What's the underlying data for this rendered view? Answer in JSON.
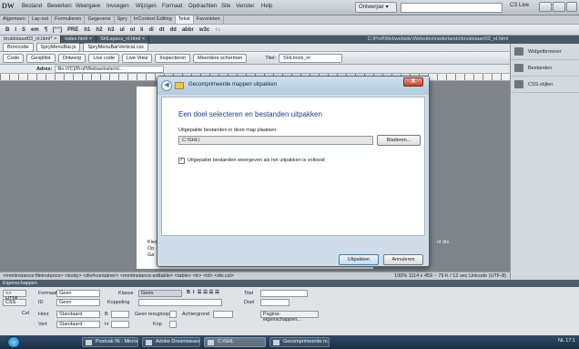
{
  "app": {
    "logo": "DW",
    "menu": [
      "Bestand",
      "Bewerken",
      "Weergave",
      "Invoegen",
      "Wijzigen",
      "Formaat",
      "Opdrachten",
      "Site",
      "Venster",
      "Help"
    ],
    "workspace": "Ontwerper ▾",
    "cslive": "CS Live"
  },
  "insert_tabs": [
    "Algemeen",
    "Lay-out",
    "Formulieren",
    "Gegevens",
    "Spry",
    "InContext Editing",
    "Tekst",
    "Favorieten"
  ],
  "format_bar": [
    "B",
    "I",
    "S",
    "em",
    "¶",
    "[“”]",
    "PRE",
    "h1",
    "h2",
    "h3",
    "ul",
    "ol",
    "li",
    "dl",
    "dt",
    "dd",
    "abbr",
    "w3c",
    "↑↓"
  ],
  "doc_tabs": [
    "bruidstaart03_nl.html* ×",
    "index.html ×",
    "SHLspecs_nl.html ×"
  ],
  "doc_path": "C:\\Prof\\Webwebsite\\Websites\\nederlands\\bruidstaart03_nl.html",
  "related_files": [
    "Broncode",
    "SpryMenuBar.js",
    "SpryMenuBarVertical.css"
  ],
  "doc_toolbar": {
    "buttons": [
      "Code",
      "Gesplitst",
      "Ontwerp",
      "Live code",
      "Live View",
      "Inspecteren",
      "Meerdere schermen"
    ],
    "title_label": "Titel:",
    "title_value": "SHLtools_nl"
  },
  "address": {
    "label": "Adres:",
    "value": "file:///C|/Prof/Webwebsite/nl..."
  },
  "status": {
    "left": "<mmtinstance:fileinstance> <body> <div#container> <mmtinstance:editable> <table> <tr> <td> <div.col>",
    "right": "100%  1114 x 459 ~ 79 K / 12 sec  Unicode (UTF-8)"
  },
  "right_panel": [
    "Widgetbrowser",
    "Bestanden",
    "CSS-stijlen"
  ],
  "background_text": {
    "left": [
      "Kiez",
      "Op",
      "Ga"
    ],
    "right": "nt die"
  },
  "properties": {
    "header": "Eigenschappen",
    "html_btn": "<> HTML",
    "css_btn": "CSS",
    "format_label": "Formaat",
    "format_value": "Geen",
    "class_label": "Klasse",
    "class_value": "Geen",
    "id_label": "ID",
    "id_value": "Geen",
    "link_label": "Koppeling",
    "title_label": "Titel",
    "target_label": "Doel",
    "cell_label": "Cel",
    "horz_label": "Horz",
    "horz_value": "Standaard",
    "vert_label": "Vert",
    "vert_value": "Standaard",
    "w_label": "B",
    "h_label": "H",
    "nowrap_label": "Geen terugloop",
    "header_label": "Kop",
    "bg_label": "Achtergrond",
    "page_props_btn": "Pagina-eigenschappen..."
  },
  "dialog": {
    "caption": "Gecomprimeerde mappen uitpakken",
    "close": "X",
    "heading": "Een doel selecteren en bestanden uitpakken",
    "path_label": "Uitgepakte bestanden in deze map plaatsen:",
    "path_value": "C:\\SHL\\",
    "browse": "Bladeren...",
    "checkbox_checked": true,
    "checkbox_label": "Uitgepakte bestanden weergeven als het uitpakken is voltooid",
    "extract": "Uitpakken",
    "cancel": "Annuleren"
  },
  "taskbar": {
    "tasks": [
      "Postvak IN - Micros...",
      "Adobe Dreamweave...",
      "C:\\SHL",
      "Gecomprimeerde m..."
    ],
    "clock": "NL  17:1"
  },
  "colors": {
    "dialog_heading": "#1e3e8c",
    "taskbar": "#1b2f44",
    "doc_bg": "#7e8488"
  }
}
